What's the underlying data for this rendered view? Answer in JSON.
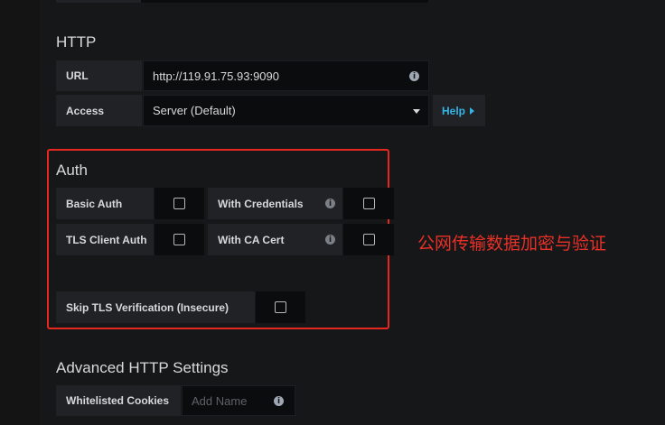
{
  "http": {
    "heading": "HTTP",
    "url": {
      "label": "URL",
      "value": "http://119.91.75.93:9090",
      "info_icon": "info-icon"
    },
    "access": {
      "label": "Access",
      "value": "Server (Default)",
      "caret_icon": "caret-down-icon"
    },
    "help": {
      "label": "Help",
      "icon": "caret-right-icon"
    }
  },
  "auth": {
    "heading": "Auth",
    "basic_auth": {
      "label": "Basic Auth",
      "checked": false
    },
    "with_credentials": {
      "label": "With Credentials",
      "checked": false,
      "info_icon": "info-icon"
    },
    "tls_client_auth": {
      "label": "TLS Client Auth",
      "checked": false
    },
    "with_ca_cert": {
      "label": "With CA Cert",
      "checked": false,
      "info_icon": "info-icon"
    },
    "skip_tls": {
      "label": "Skip TLS Verification (Insecure)",
      "checked": false
    }
  },
  "annotation": {
    "text": "公网传输数据加密与验证",
    "color": "#e83027"
  },
  "advanced": {
    "heading": "Advanced HTTP Settings",
    "whitelisted_cookies": {
      "label": "Whitelisted Cookies",
      "placeholder": "Add Name",
      "info_icon": "info-icon"
    }
  },
  "colors": {
    "background": "#161719",
    "label_bg": "#202226",
    "input_bg": "#0b0c0e",
    "link": "#33b5e5",
    "highlight": "#e8271e"
  }
}
